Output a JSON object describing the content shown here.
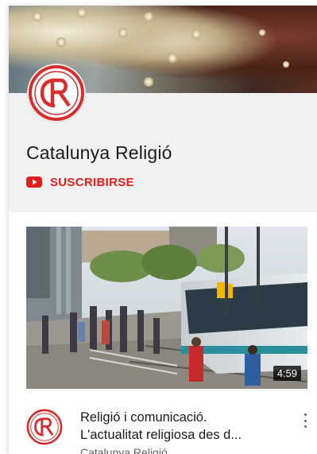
{
  "channel": {
    "name": "Catalunya Religió",
    "logo_text": "CR",
    "subscribe_label": "SUSCRIBIRSE"
  },
  "video": {
    "title_line1": "Religió i comunicació.",
    "title_line2": "L'actualitat religiosa des d...",
    "channel": "Catalunya Religió",
    "duration": "4:59"
  },
  "colors": {
    "accent": "#e0201b",
    "header_bg": "#f1f1f1"
  },
  "icons": {
    "subscribe": "youtube-play-icon",
    "menu": "more-vertical-icon"
  }
}
